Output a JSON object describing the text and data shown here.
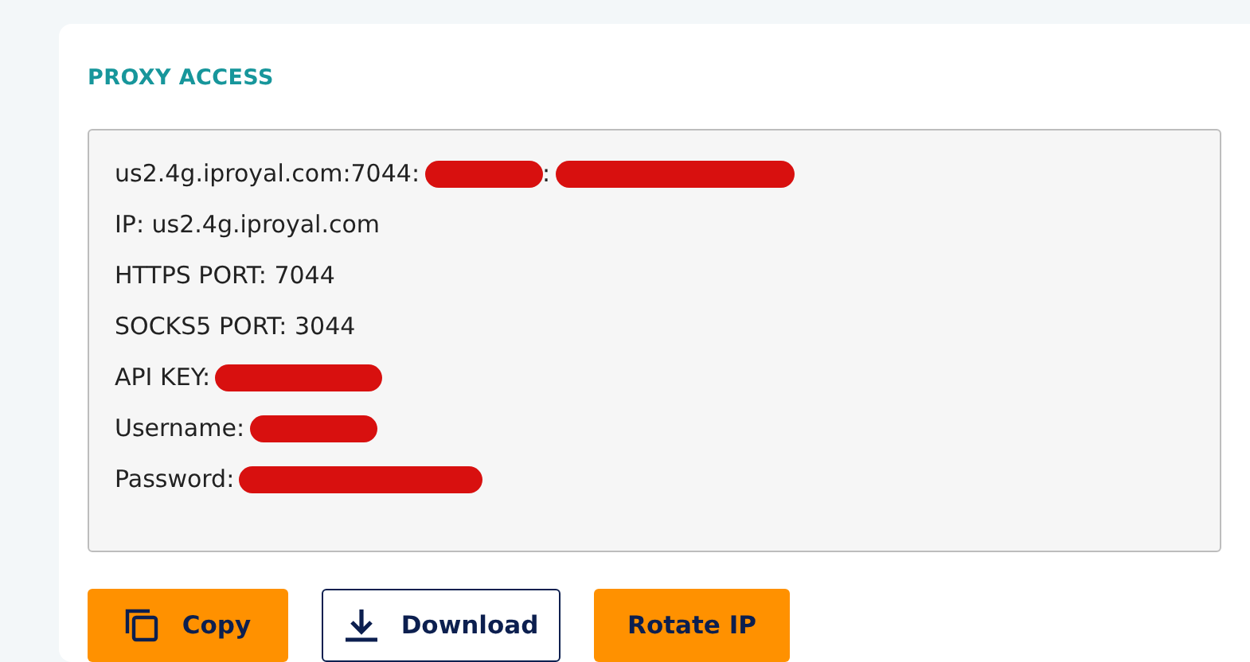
{
  "section": {
    "title": "PROXY ACCESS"
  },
  "credentials": [
    {
      "parts": [
        {
          "kind": "text",
          "text": "us2.4g.iproyal.com:7044:"
        },
        {
          "kind": "redaction"
        },
        {
          "kind": "text",
          "text": ":"
        },
        {
          "kind": "redaction"
        }
      ]
    },
    {
      "parts": [
        {
          "kind": "text",
          "text": "IP: us2.4g.iproyal.com"
        }
      ]
    },
    {
      "parts": [
        {
          "kind": "text",
          "text": "HTTPS PORT: 7044"
        }
      ]
    },
    {
      "parts": [
        {
          "kind": "text",
          "text": "SOCKS5 PORT: 3044"
        }
      ]
    },
    {
      "parts": [
        {
          "kind": "text",
          "text": "API KEY:"
        },
        {
          "kind": "redaction"
        }
      ]
    },
    {
      "parts": [
        {
          "kind": "text",
          "text": "Username:"
        },
        {
          "kind": "redaction"
        }
      ]
    },
    {
      "parts": [
        {
          "kind": "text",
          "text": "Password:"
        },
        {
          "kind": "redaction"
        }
      ]
    }
  ],
  "buttons": [
    {
      "label": "Copy",
      "kind": "copy"
    },
    {
      "label": "Download",
      "kind": "download"
    },
    {
      "label": "Rotate IP",
      "kind": "rotate"
    }
  ]
}
